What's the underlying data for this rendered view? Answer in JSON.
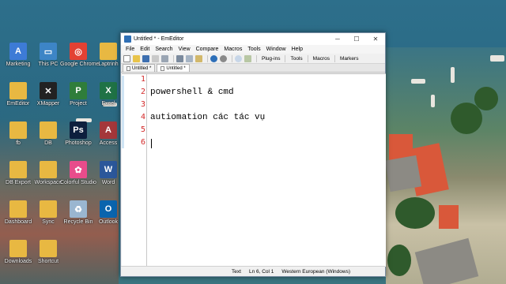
{
  "desktop": {
    "icons": [
      {
        "label": "Marketing",
        "color": "#3d7bd6",
        "glyph": "A"
      },
      {
        "label": "This PC",
        "color": "#3d85c6",
        "glyph": "▭"
      },
      {
        "label": "Google Chrome",
        "color": "#e34133",
        "glyph": "◎"
      },
      {
        "label": "Laptrinh",
        "color": "#e8b842",
        "glyph": ""
      },
      {
        "label": "EmEditor",
        "color": "#e8b842",
        "glyph": ""
      },
      {
        "label": "XMapper",
        "color": "#222222",
        "glyph": "✕"
      },
      {
        "label": "Project",
        "color": "#2f7d3a",
        "glyph": "P"
      },
      {
        "label": "Excel",
        "color": "#1f7245",
        "glyph": "X"
      },
      {
        "label": "fb",
        "color": "#e8b842",
        "glyph": ""
      },
      {
        "label": "DB",
        "color": "#e8b842",
        "glyph": ""
      },
      {
        "label": "Photoshop",
        "color": "#0d1f3d",
        "glyph": "Ps"
      },
      {
        "label": "Access",
        "color": "#a4373a",
        "glyph": "A"
      },
      {
        "label": "DB Export",
        "color": "#e8b842",
        "glyph": ""
      },
      {
        "label": "Workspace",
        "color": "#e8b842",
        "glyph": ""
      },
      {
        "label": "Colorful Studio",
        "color": "#e84c8b",
        "glyph": "✿"
      },
      {
        "label": "Word",
        "color": "#2b579a",
        "glyph": "W"
      },
      {
        "label": "Dashboard",
        "color": "#e8b842",
        "glyph": ""
      },
      {
        "label": "Sync",
        "color": "#e8b842",
        "glyph": ""
      },
      {
        "label": "Recycle Bin",
        "color": "#9ab6d0",
        "glyph": "♻"
      },
      {
        "label": "Outlook",
        "color": "#0a64ad",
        "glyph": "O"
      },
      {
        "label": "Downloads",
        "color": "#e8b842",
        "glyph": ""
      },
      {
        "label": "Shortcut",
        "color": "#e8b842",
        "glyph": ""
      }
    ]
  },
  "window": {
    "title": "Untitled * - EmEditor",
    "menu": [
      "File",
      "Edit",
      "Search",
      "View",
      "Compare",
      "Macros",
      "Tools",
      "Window",
      "Help"
    ],
    "toolbar_text": {
      "plugins": "Plug-ins",
      "tools": "Tools",
      "macros": "Macros",
      "markers": "Markers"
    },
    "tabs": [
      {
        "label": "Untitled *",
        "active": false
      },
      {
        "label": "Untitled *",
        "active": true
      }
    ],
    "line_numbers": [
      "1",
      "2",
      "3",
      "4",
      "5",
      "6"
    ],
    "lines": [
      "",
      "powershell & cmd",
      "",
      "autiomation các tác vụ",
      "",
      ""
    ],
    "status": {
      "mode": "Text",
      "position": "Ln 6, Col 1",
      "encoding": "Western European (Windows)"
    }
  },
  "colors": {
    "line_number": "#d32a2a",
    "accent": "#2f6fb5"
  }
}
